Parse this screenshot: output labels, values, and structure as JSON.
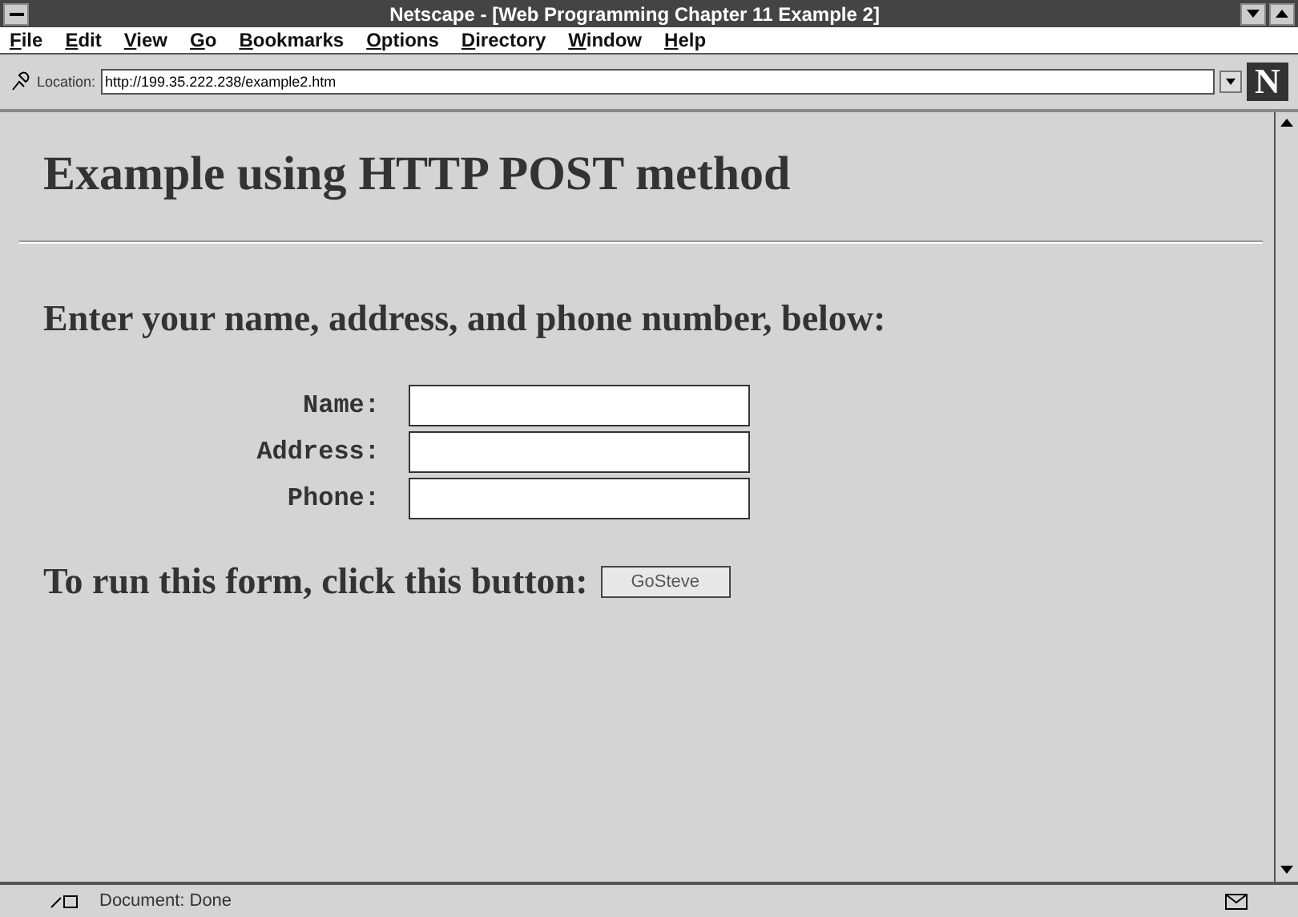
{
  "window": {
    "title": "Netscape - [Web Programming Chapter 11 Example 2]"
  },
  "menu": [
    "File",
    "Edit",
    "View",
    "Go",
    "Bookmarks",
    "Options",
    "Directory",
    "Window",
    "Help"
  ],
  "location": {
    "label": "Location:",
    "value": "http://199.35.222.238/example2.htm"
  },
  "logo": "N",
  "page": {
    "heading": "Example using HTTP POST method",
    "prompt": "Enter your name, address, and phone number, below:",
    "fields": [
      {
        "label": "Name:"
      },
      {
        "label": "Address:"
      },
      {
        "label": "Phone:"
      }
    ],
    "run_text": "To run this form, click this button:",
    "button": "GoSteve"
  },
  "status_bar": {
    "text": "Document: Done"
  }
}
